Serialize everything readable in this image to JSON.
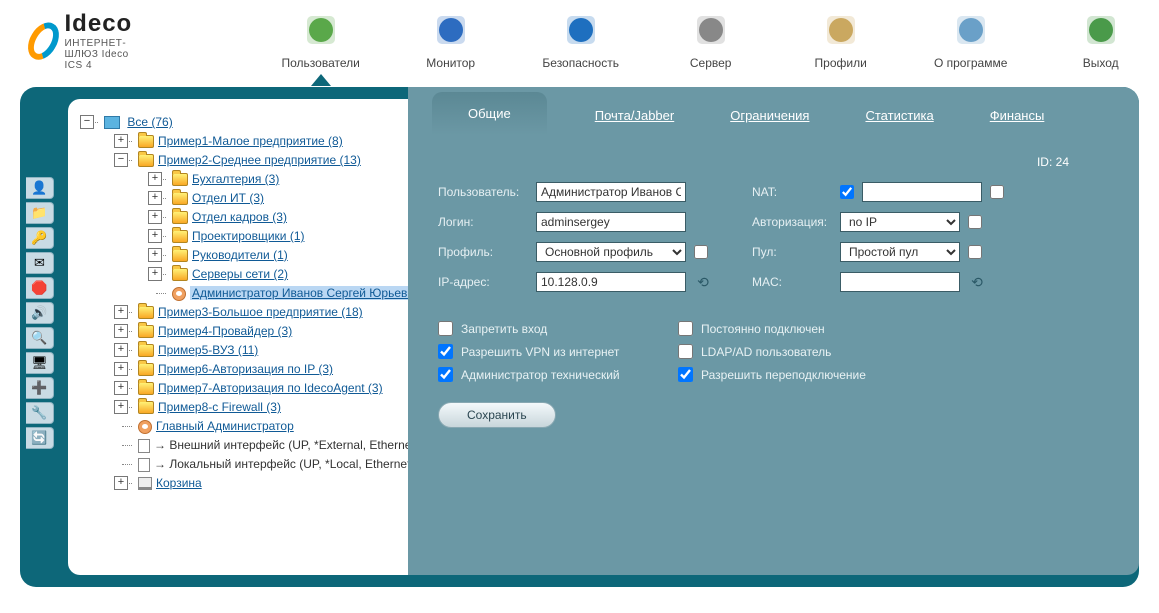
{
  "brand": {
    "name": "Ideco",
    "subtitle": "ИНТЕРНЕТ-ШЛЮЗ Ideco ICS 4"
  },
  "topnav": [
    {
      "label": "Пользователи",
      "active": true,
      "icon": "users"
    },
    {
      "label": "Монитор",
      "active": false,
      "icon": "monitor"
    },
    {
      "label": "Безопасность",
      "active": false,
      "icon": "shield"
    },
    {
      "label": "Сервер",
      "active": false,
      "icon": "server"
    },
    {
      "label": "Профили",
      "active": false,
      "icon": "profile"
    },
    {
      "label": "О программе",
      "active": false,
      "icon": "about"
    },
    {
      "label": "Выход",
      "active": false,
      "icon": "exit"
    }
  ],
  "side_tools": [
    "👤",
    "📁",
    "🔑",
    "✉",
    "🛑",
    "🔊",
    "🔍",
    "🖥",
    "➕",
    "🔧",
    "🔄"
  ],
  "tree": {
    "root_label": "Все (76)",
    "nodes": [
      {
        "label": "Пример1-Малое предприятие (8)",
        "expand": "plus"
      },
      {
        "label": "Пример2-Среднее предприятие (13)",
        "expand": "minus",
        "children": [
          {
            "label": "Бухгалтерия (3)",
            "expand": "plus"
          },
          {
            "label": "Отдел ИТ (3)",
            "expand": "plus"
          },
          {
            "label": "Отдел кадров (3)",
            "expand": "plus"
          },
          {
            "label": "Проектировщики (1)",
            "expand": "plus"
          },
          {
            "label": "Руководители (1)",
            "expand": "plus"
          },
          {
            "label": "Серверы сети (2)",
            "expand": "plus"
          },
          {
            "label": "Администратор Иванов Сергей Юрьевич",
            "user": true,
            "selected": true
          }
        ]
      },
      {
        "label": "Пример3-Большое предприятие (18)",
        "expand": "plus"
      },
      {
        "label": "Пример4-Провайдер (3)",
        "expand": "plus"
      },
      {
        "label": "Пример5-ВУЗ (11)",
        "expand": "plus"
      },
      {
        "label": "Пример6-Авторизация по IP (3)",
        "expand": "plus"
      },
      {
        "label": "Пример7-Авторизация по IdecoAgent (3)",
        "expand": "plus"
      },
      {
        "label": "Пример8-с Firewall (3)",
        "expand": "plus"
      },
      {
        "label": "Главный Администратор",
        "user": true
      },
      {
        "label": "→ Внешний интерфейс (UP, *External, Ethernet)",
        "iface": true
      },
      {
        "label": "→ Локальный интерфейс (UP, *Local, Ethernet)",
        "iface": true
      },
      {
        "label": "Корзина",
        "bin": true,
        "expand": "plus"
      }
    ]
  },
  "tabs": [
    {
      "label": "Общие",
      "active": true
    },
    {
      "label": "Почта/Jabber",
      "active": false
    },
    {
      "label": "Ограничения",
      "active": false
    },
    {
      "label": "Статистика",
      "active": false
    },
    {
      "label": "Финансы",
      "active": false
    }
  ],
  "form": {
    "id_prefix": "ID:",
    "id_value": "24",
    "left": {
      "user_label": "Пользователь:",
      "user_value": "Администратор Иванов Сергей Юрьевич",
      "login_label": "Логин:",
      "login_value": "adminsergey",
      "profile_label": "Профиль:",
      "profile_value": "Основной профиль",
      "ip_label": "IP-адрес:",
      "ip_value": "10.128.0.9"
    },
    "right": {
      "nat_label": "NAT:",
      "nat_checked": true,
      "auth_label": "Авторизация:",
      "auth_value": "no IP",
      "pool_label": "Пул:",
      "pool_value": "Простой пул",
      "mac_label": "MAC:",
      "mac_value": ""
    },
    "checks": [
      {
        "label": "Запретить вход",
        "checked": false
      },
      {
        "label": "Постоянно подключен",
        "checked": false
      },
      {
        "label": "Разрешить VPN из интернет",
        "checked": true
      },
      {
        "label": "LDAP/AD пользователь",
        "checked": false
      },
      {
        "label": "Администратор технический",
        "checked": true
      },
      {
        "label": "Разрешить переподключение",
        "checked": true
      }
    ],
    "save_label": "Сохранить"
  }
}
